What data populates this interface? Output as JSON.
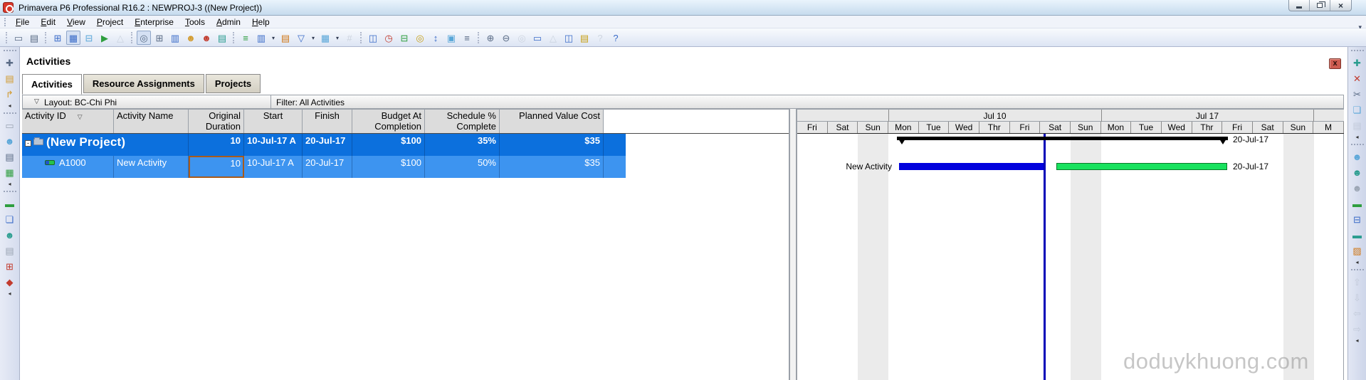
{
  "window": {
    "title": "Primavera P6 Professional R16.2 : NEWPROJ-3 ((New Project))",
    "close_glyph": "×"
  },
  "menu": {
    "items": [
      "File",
      "Edit",
      "View",
      "Project",
      "Enterprise",
      "Tools",
      "Admin",
      "Help"
    ]
  },
  "toolbar": {
    "overflow_icon": "▾",
    "groups": [
      [
        {
          "n": "print-preview-icon",
          "g": "▭",
          "c": "g-slate"
        },
        {
          "n": "print-icon",
          "g": "▤",
          "c": "g-slate"
        }
      ],
      [
        {
          "n": "table-view-icon",
          "g": "⊞",
          "c": "g-blue"
        },
        {
          "n": "layout-icon",
          "g": "▦",
          "c": "g-blue pressed"
        },
        {
          "n": "trace-logic-icon",
          "g": "⊟",
          "c": "g-sky"
        },
        {
          "n": "progress-line-icon",
          "g": "▶",
          "c": "g-green"
        },
        {
          "n": "update-progress-icon",
          "g": "△",
          "c": "g-gray disabled"
        }
      ],
      [
        {
          "n": "activities-window-icon",
          "g": "◎",
          "c": "g-slate pressed"
        },
        {
          "n": "wbs-window-icon",
          "g": "⊞",
          "c": "g-slate"
        },
        {
          "n": "projects-window-icon",
          "g": "▥",
          "c": "g-blue"
        },
        {
          "n": "resources-window-icon",
          "g": "☻",
          "c": "g-amber"
        },
        {
          "n": "obs-window-icon",
          "g": "☻",
          "c": "g-red"
        },
        {
          "n": "wps-docs-window-icon",
          "g": "▤",
          "c": "g-teal"
        }
      ],
      [
        {
          "n": "group-sort-icon",
          "g": "≡",
          "c": "g-green"
        },
        {
          "n": "columns-icon",
          "g": "▥",
          "c": "g-blue"
        },
        {
          "n": "columns-dropdown-icon",
          "g": "▾",
          "c": "dd"
        },
        {
          "n": "bars-icon",
          "g": "▤",
          "c": "g-orange"
        },
        {
          "n": "filters-icon",
          "g": "▽",
          "c": "g-blue"
        },
        {
          "n": "filters-dropdown-icon",
          "g": "▾",
          "c": "dd"
        },
        {
          "n": "group-and-sort-icon",
          "g": "▦",
          "c": "g-sky"
        },
        {
          "n": "group-dropdown-icon",
          "g": "▾",
          "c": "dd"
        },
        {
          "n": "activity-codes-icon",
          "g": "#",
          "c": "g-gray disabled"
        }
      ],
      [
        {
          "n": "activity-details-icon",
          "g": "◫",
          "c": "g-blue"
        },
        {
          "n": "schedule-icon",
          "g": "◷",
          "c": "g-red"
        },
        {
          "n": "relationships-icon",
          "g": "⊟",
          "c": "g-green"
        },
        {
          "n": "global-change-icon",
          "g": "◎",
          "c": "g-yellow"
        },
        {
          "n": "level-resources-icon",
          "g": "↕",
          "c": "g-blue"
        },
        {
          "n": "copy-project-icon",
          "g": "▣",
          "c": "g-sky"
        },
        {
          "n": "resource-list-icon",
          "g": "≡",
          "c": "g-slate"
        }
      ],
      [
        {
          "n": "zoom-in-icon",
          "g": "⊕",
          "c": "g-slate"
        },
        {
          "n": "zoom-out-icon",
          "g": "⊖",
          "c": "g-slate"
        },
        {
          "n": "zoom-100-icon",
          "g": "◎",
          "c": "g-gray disabled"
        },
        {
          "n": "fit-screen-icon",
          "g": "▭",
          "c": "g-blue"
        },
        {
          "n": "collapse-all-icon",
          "g": "△",
          "c": "g-gray disabled"
        },
        {
          "n": "split-view-icon",
          "g": "◫",
          "c": "g-blue"
        },
        {
          "n": "notebook-icon",
          "g": "▤",
          "c": "g-yellow"
        },
        {
          "n": "help-icon",
          "g": "?",
          "c": "g-gray disabled"
        },
        {
          "n": "online-help-icon",
          "g": "?",
          "c": "g-blue"
        }
      ]
    ]
  },
  "workspace": {
    "title": "Activities",
    "close_icon": "x"
  },
  "tabs": [
    {
      "label": "Activities"
    },
    {
      "label": "Resource Assignments"
    },
    {
      "label": "Projects"
    }
  ],
  "layout_bar": {
    "chevron_icon": "▽",
    "layout_label": "Layout: BC-Chi Phi",
    "filter_label": "Filter: All Activities"
  },
  "table": {
    "sort_icon": "▽",
    "columns": [
      "Activity ID",
      "Activity Name",
      "Original Duration",
      "Start",
      "Finish",
      "Budget At Completion",
      "Schedule % Complete",
      "Planned Value Cost"
    ],
    "group_row": {
      "expand_icon": "-",
      "name": "(New Project)",
      "original_duration": "10",
      "start": "10-Jul-17 A",
      "finish": "20-Jul-17",
      "budget_at_completion": "$100",
      "schedule_pct": "35%",
      "planned_value_cost": "$35"
    },
    "activity_row": {
      "activity_id": "A1000",
      "activity_name": "New Activity",
      "original_duration": "10",
      "start": "10-Jul-17 A",
      "finish": "20-Jul-17",
      "budget_at_completion": "$100",
      "schedule_pct": "50%",
      "planned_value_cost": "$35"
    }
  },
  "gantt": {
    "weeks": [
      "Jul 10",
      "Jul 17"
    ],
    "days": [
      "Fri",
      "Sat",
      "Sun",
      "Mon",
      "Tue",
      "Wed",
      "Thr",
      "Fri",
      "Sat",
      "Sun",
      "Mon",
      "Tue",
      "Wed",
      "Thr",
      "Fri",
      "Sat",
      "Sun",
      "M"
    ],
    "summary_bar_label": "20-Jul-17",
    "activity_bar_left_label": "New Activity",
    "activity_bar_right_label": "20-Jul-17"
  },
  "left_toolbar": {
    "items": [
      {
        "n": "drag-handle",
        "g": "",
        "c": "handle"
      },
      {
        "n": "new-project-icon",
        "g": "✚",
        "c": "g-slate"
      },
      {
        "n": "open-project-icon",
        "g": "▤",
        "c": "g-amber"
      },
      {
        "n": "import-icon",
        "g": "↱",
        "c": "g-amber"
      },
      {
        "n": "collapse-icon",
        "g": "◂",
        "c": "collapse"
      },
      {
        "n": "drag-handle",
        "g": "",
        "c": "handle"
      },
      {
        "n": "projects-folder-icon",
        "g": "▭",
        "c": "g-gray"
      },
      {
        "n": "resources-icon",
        "g": "☻",
        "c": "g-sky"
      },
      {
        "n": "reports-icon",
        "g": "▤",
        "c": "g-slate"
      },
      {
        "n": "tracking-icon",
        "g": "▦",
        "c": "g-green"
      },
      {
        "n": "collapse-icon",
        "g": "◂",
        "c": "collapse"
      },
      {
        "n": "drag-handle",
        "g": "",
        "c": "handle"
      },
      {
        "n": "activities-icon",
        "g": "▬",
        "c": "g-green"
      },
      {
        "n": "wbs-icon",
        "g": "❏",
        "c": "g-blue"
      },
      {
        "n": "assignments-icon",
        "g": "☻",
        "c": "g-teal"
      },
      {
        "n": "wps-docs-icon",
        "g": "▤",
        "c": "g-gray"
      },
      {
        "n": "expenses-icon",
        "g": "⊞",
        "c": "g-red"
      },
      {
        "n": "risks-icon",
        "g": "◆",
        "c": "g-red"
      },
      {
        "n": "collapse-icon",
        "g": "◂",
        "c": "collapse"
      }
    ]
  },
  "right_toolbar": {
    "items": [
      {
        "n": "drag-handle",
        "g": "",
        "c": "handle"
      },
      {
        "n": "add-icon",
        "g": "✚",
        "c": "g-teal"
      },
      {
        "n": "delete-icon",
        "g": "✕",
        "c": "g-red"
      },
      {
        "n": "cut-icon",
        "g": "✂",
        "c": "g-slate"
      },
      {
        "n": "copy-icon",
        "g": "❏",
        "c": "g-sky"
      },
      {
        "n": "paste-icon",
        "g": "▤",
        "c": "g-gray disabled"
      },
      {
        "n": "collapse-icon",
        "g": "◂",
        "c": "collapse"
      },
      {
        "n": "drag-handle",
        "g": "",
        "c": "handle"
      },
      {
        "n": "assign-resource-icon",
        "g": "☻",
        "c": "g-sky"
      },
      {
        "n": "assign-resource-by-role-icon",
        "g": "☻",
        "c": "g-teal"
      },
      {
        "n": "assign-role-icon",
        "g": "☻",
        "c": "g-gray"
      },
      {
        "n": "assign-activity-code-icon",
        "g": "▬",
        "c": "g-green"
      },
      {
        "n": "assign-predecessor-icon",
        "g": "⊟",
        "c": "g-blue"
      },
      {
        "n": "assign-successor-icon",
        "g": "▬",
        "c": "g-teal"
      },
      {
        "n": "activity-steps-icon",
        "g": "▨",
        "c": "g-orange"
      },
      {
        "n": "collapse-icon",
        "g": "◂",
        "c": "collapse"
      },
      {
        "n": "drag-handle",
        "g": "",
        "c": "handle"
      },
      {
        "n": "move-up-icon",
        "g": "⇧",
        "c": "g-gray disabled"
      },
      {
        "n": "move-down-icon",
        "g": "⇩",
        "c": "g-gray disabled"
      },
      {
        "n": "move-left-icon",
        "g": "⇦",
        "c": "g-gray disabled"
      },
      {
        "n": "move-right-icon",
        "g": "⇨",
        "c": "g-gray disabled"
      },
      {
        "n": "collapse-icon",
        "g": "◂",
        "c": "collapse"
      }
    ]
  },
  "watermark": "doduykhuong.com"
}
